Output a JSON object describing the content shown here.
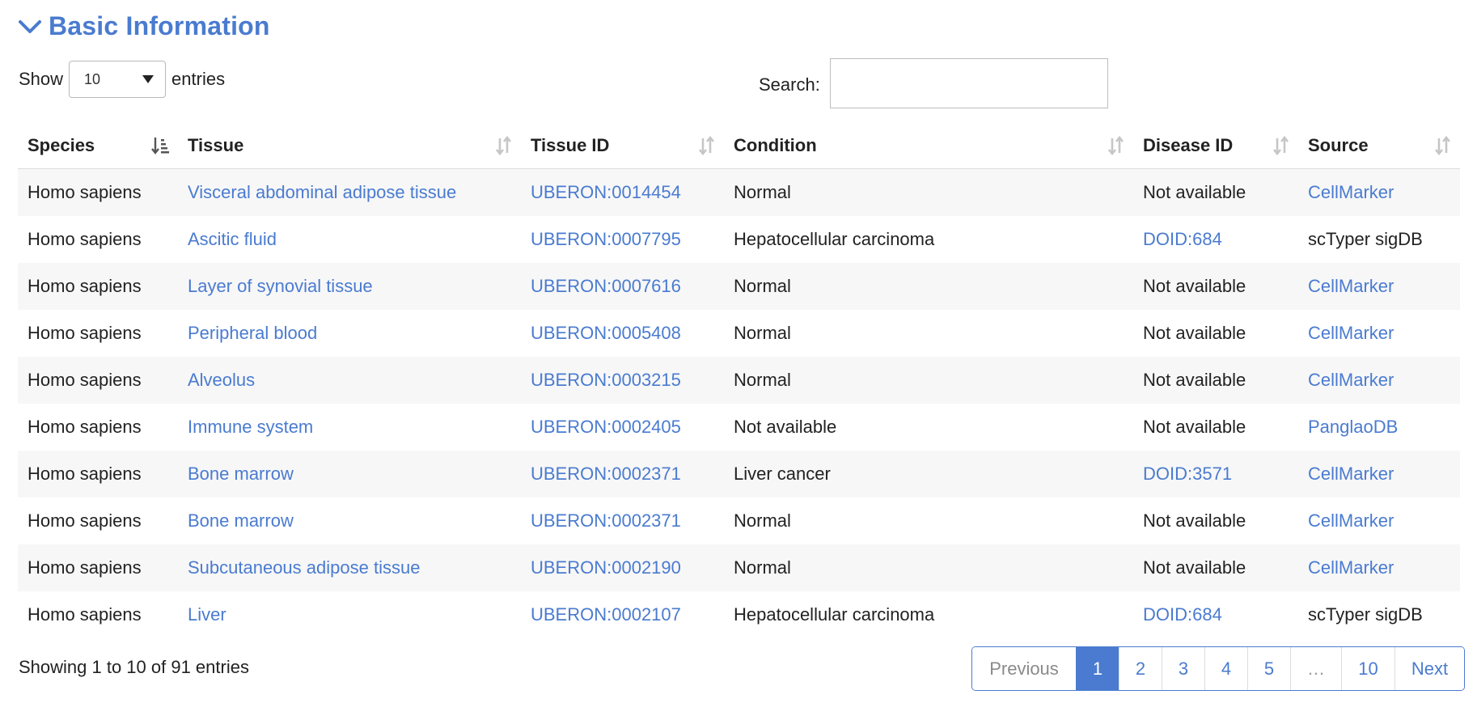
{
  "section": {
    "title": "Basic Information"
  },
  "length_control": {
    "show_label": "Show",
    "selected": "10",
    "entries_label": "entries"
  },
  "search": {
    "label": "Search:",
    "value": ""
  },
  "table": {
    "columns": [
      "Species",
      "Tissue",
      "Tissue ID",
      "Condition",
      "Disease ID",
      "Source"
    ],
    "rows": [
      [
        "Homo sapiens",
        "Visceral abdominal adipose tissue",
        "UBERON:0014454",
        "Normal",
        "Not available",
        "CellMarker"
      ],
      [
        "Homo sapiens",
        "Ascitic fluid",
        "UBERON:0007795",
        "Hepatocellular carcinoma",
        "DOID:684",
        "scTyper sigDB"
      ],
      [
        "Homo sapiens",
        "Layer of synovial tissue",
        "UBERON:0007616",
        "Normal",
        "Not available",
        "CellMarker"
      ],
      [
        "Homo sapiens",
        "Peripheral blood",
        "UBERON:0005408",
        "Normal",
        "Not available",
        "CellMarker"
      ],
      [
        "Homo sapiens",
        "Alveolus",
        "UBERON:0003215",
        "Normal",
        "Not available",
        "CellMarker"
      ],
      [
        "Homo sapiens",
        "Immune system",
        "UBERON:0002405",
        "Not available",
        "Not available",
        "PanglaoDB"
      ],
      [
        "Homo sapiens",
        "Bone marrow",
        "UBERON:0002371",
        "Liver cancer",
        "DOID:3571",
        "CellMarker"
      ],
      [
        "Homo sapiens",
        "Bone marrow",
        "UBERON:0002371",
        "Normal",
        "Not available",
        "CellMarker"
      ],
      [
        "Homo sapiens",
        "Subcutaneous adipose tissue",
        "UBERON:0002190",
        "Normal",
        "Not available",
        "CellMarker"
      ],
      [
        "Homo sapiens",
        "Liver",
        "UBERON:0002107",
        "Hepatocellular carcinoma",
        "DOID:684",
        "scTyper sigDB"
      ]
    ]
  },
  "footer": {
    "info": "Showing 1 to 10 of 91 entries"
  },
  "pagination": {
    "previous": "Previous",
    "pages": [
      "1",
      "2",
      "3",
      "4",
      "5",
      "…",
      "10"
    ],
    "active": "1",
    "next": "Next"
  },
  "colors": {
    "link": "#4a7bd0",
    "accent": "#4a7bd0",
    "row_stripe": "#f7f7f7"
  }
}
